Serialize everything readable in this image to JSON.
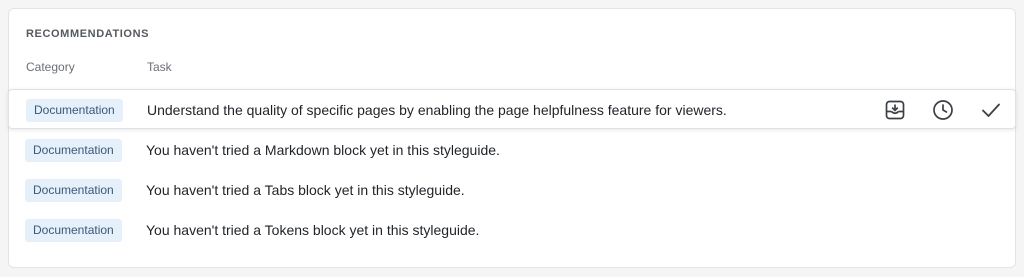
{
  "section": {
    "title": "RECOMMENDATIONS"
  },
  "columns": {
    "category": "Category",
    "task": "Task"
  },
  "rows": [
    {
      "category": "Documentation",
      "task": "Understand the quality of specific pages by enabling the page helpfulness feature for viewers."
    },
    {
      "category": "Documentation",
      "task": "You haven't tried a Markdown block yet in this styleguide."
    },
    {
      "category": "Documentation",
      "task": "You haven't tried a Tabs block yet in this styleguide."
    },
    {
      "category": "Documentation",
      "task": "You haven't tried a Tokens block yet in this styleguide."
    }
  ],
  "actions": {
    "archive_icon": "archive-icon",
    "snooze_icon": "clock-icon",
    "complete_icon": "checkmark-icon"
  },
  "colors": {
    "badge_bg": "#e6f0fa",
    "badge_text": "#3a5878",
    "text": "#1f2328",
    "muted": "#6b7076"
  }
}
